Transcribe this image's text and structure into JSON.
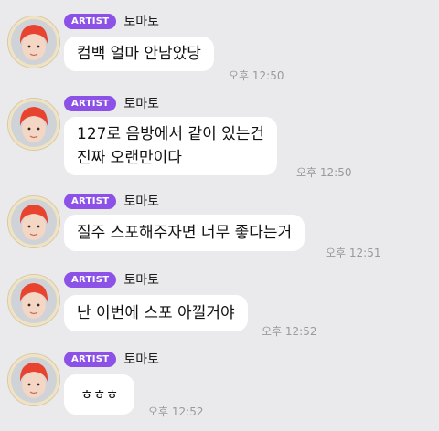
{
  "artist_badge": "ARTIST",
  "sender_name": "토마토",
  "messages": [
    {
      "text_lines": [
        "컴백 얼마 안남았당"
      ],
      "time": "오후 12:50"
    },
    {
      "text_lines": [
        "127로 음방에서 같이 있는건",
        "진짜 오랜만이다"
      ],
      "time": "오후 12:50"
    },
    {
      "text_lines": [
        "질주 스포해주자면 너무 좋다는거"
      ],
      "time": "오후 12:51"
    },
    {
      "text_lines": [
        "난 이번에 스포 아낄거야"
      ],
      "time": "오후 12:52"
    },
    {
      "text_lines": [
        "ㅎㅎㅎ"
      ],
      "time": "오후 12:52"
    }
  ],
  "colors": {
    "background": "#eaeaec",
    "badge": "#8c52e8",
    "bubble": "#ffffff",
    "timestamp": "#9a9a9a"
  }
}
